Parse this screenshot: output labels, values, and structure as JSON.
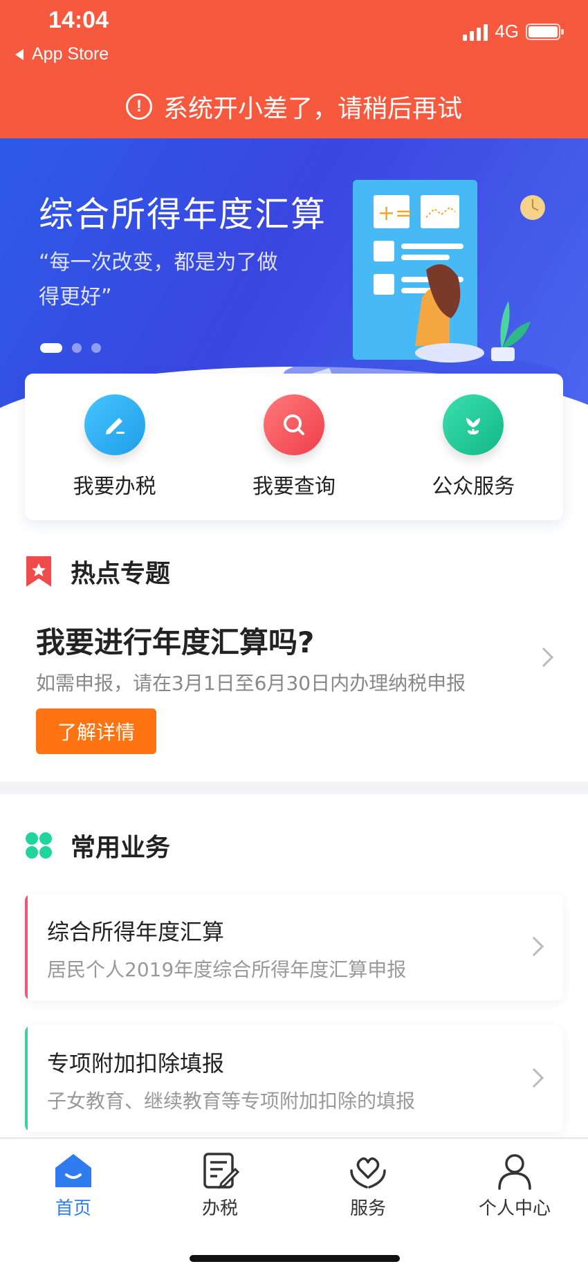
{
  "status_bar": {
    "time": "14:04",
    "back_app": "App Store",
    "network": "4G"
  },
  "error_banner": {
    "icon": "warning-circle-icon",
    "message": "系统开小差了，请稍后再试"
  },
  "hero": {
    "title": "综合所得年度汇算",
    "quote": "“每一次改变，都是为了做得更好”",
    "slide_count": 3,
    "active_slide": 1
  },
  "quick_actions": [
    {
      "label": "我要办税",
      "icon": "pen-edit-icon",
      "color": "#2bb3f0"
    },
    {
      "label": "我要查询",
      "icon": "search-icon",
      "color": "#f4545a"
    },
    {
      "label": "公众服务",
      "icon": "flower-icon",
      "color": "#1fc99a"
    }
  ],
  "hot_topics": {
    "heading": "热点专题",
    "title": "我要进行年度汇算吗?",
    "subtitle": "如需申报，请在3月1日至6月30日内办理纳税申报",
    "button": "了解详情"
  },
  "common_services": {
    "heading": "常用业务",
    "items": [
      {
        "title": "综合所得年度汇算",
        "subtitle": "居民个人2019年度综合所得年度汇算申报",
        "accent": "#f0567a"
      },
      {
        "title": "专项附加扣除填报",
        "subtitle": "子女教育、继续教育等专项附加扣除的填报",
        "accent": "#3ad19b"
      }
    ]
  },
  "tab_bar": {
    "tabs": [
      {
        "label": "首页",
        "icon": "home-icon",
        "active": true
      },
      {
        "label": "办税",
        "icon": "document-edit-icon",
        "active": false
      },
      {
        "label": "服务",
        "icon": "heart-hands-icon",
        "active": false
      },
      {
        "label": "个人中心",
        "icon": "person-icon",
        "active": false
      }
    ]
  },
  "colors": {
    "error_banner_bg": "#f7593f",
    "hero_bg": "#3a46e0",
    "detail_button": "#ff7313",
    "active_tab": "#2f7bf0"
  }
}
